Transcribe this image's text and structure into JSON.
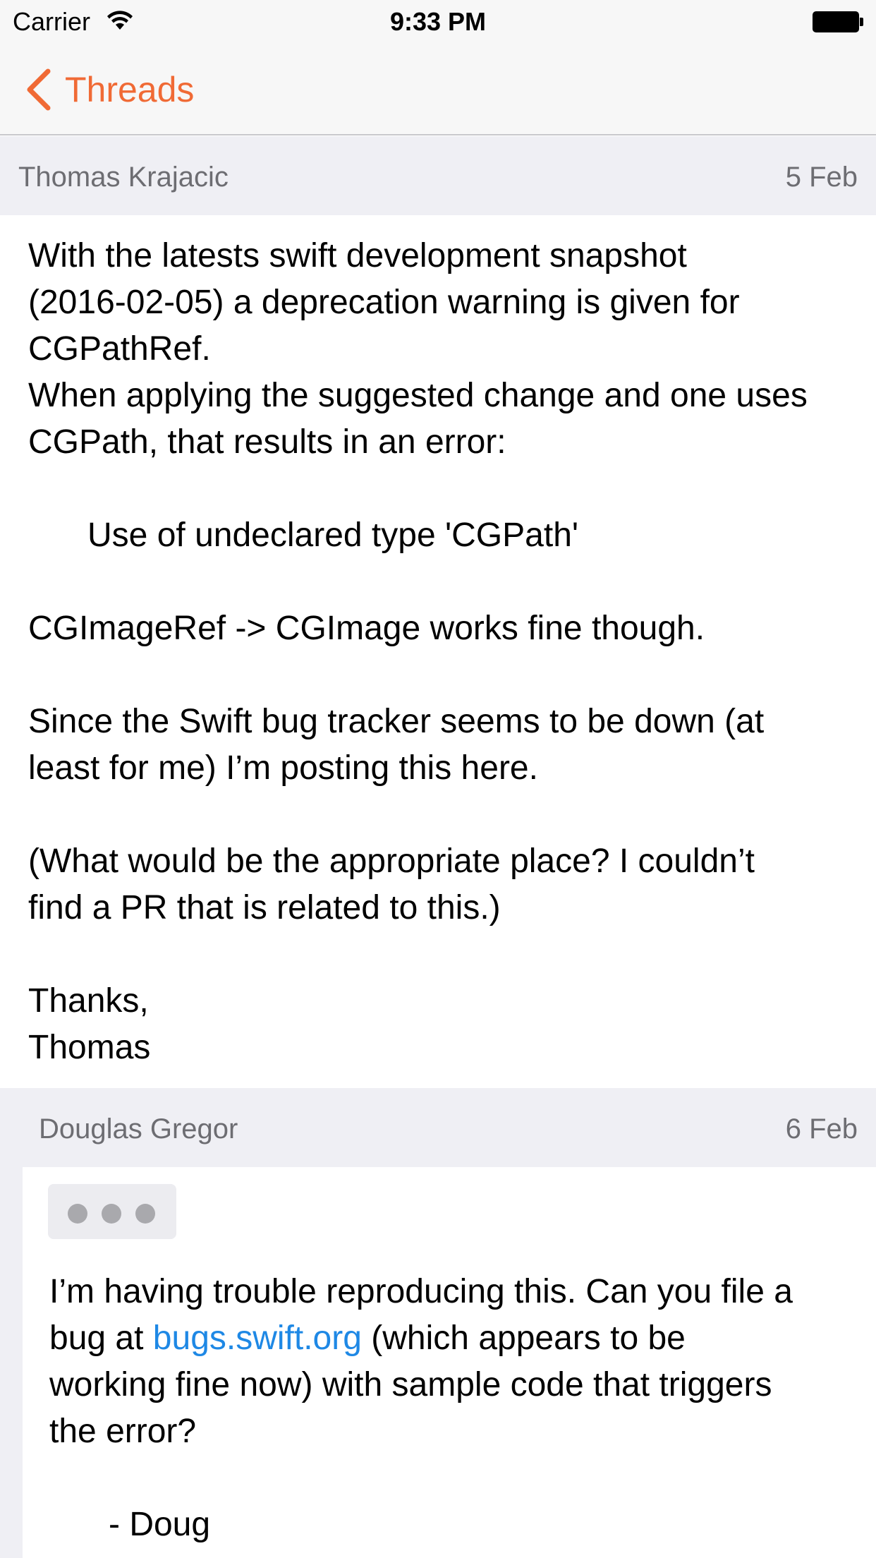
{
  "status_bar": {
    "carrier": "Carrier",
    "time": "9:33 PM"
  },
  "nav": {
    "back_label": "Threads",
    "accent_color": "#f06a35"
  },
  "messages": [
    {
      "author": "Thomas Krajacic",
      "date": "5 Feb",
      "lines": [
        "With the latests swift development snapshot",
        "(2016-02-05) a deprecation warning is given for",
        "CGPathRef.",
        "When applying the suggested change and one uses",
        "CGPath, that results in an error:",
        "",
        "Use of undeclared type 'CGPath'",
        "",
        "CGImageRef -> CGImage works fine though.",
        "",
        "Since the Swift bug tracker seems to be down (at",
        "least for me) I’m posting this here.",
        "",
        "(What would be the appropriate place? I couldn’t",
        "find a PR that is related to this.)",
        "",
        "Thanks,",
        "Thomas"
      ]
    },
    {
      "author": "Douglas Gregor",
      "date": "6 Feb",
      "line1": "I’m having trouble reproducing this. Can you file a",
      "line2_prefix": "bug at ",
      "link_text": "bugs.swift.org",
      "line2_suffix": " (which appears to be",
      "line3": "working fine now) with sample code that triggers",
      "line4": "the error?",
      "signature": "- Doug",
      "link_color": "#1e88e5"
    }
  ]
}
